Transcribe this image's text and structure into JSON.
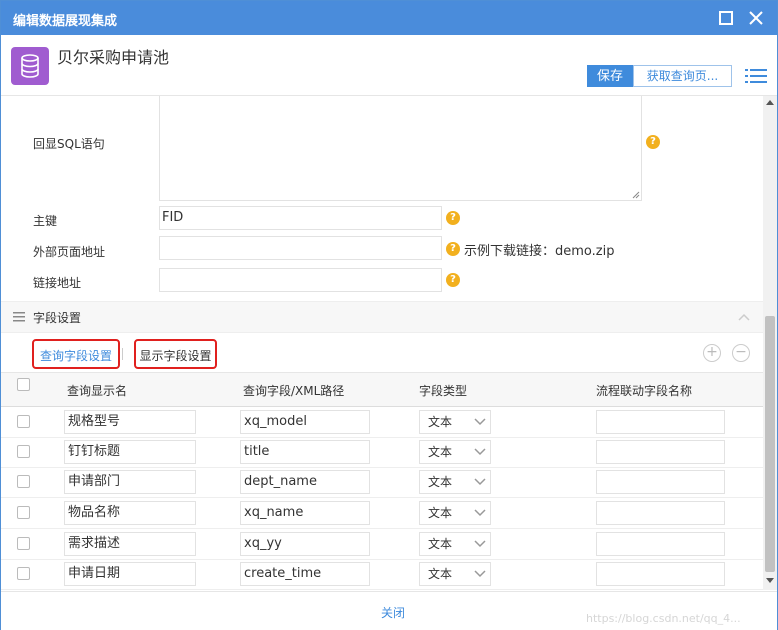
{
  "window": {
    "title": "编辑数据展现集成"
  },
  "header": {
    "app_title": "贝尔采购申请池",
    "save_label": "保存",
    "fetch_label": "获取查询页..."
  },
  "form": {
    "sql_label": "回显SQL语句",
    "pk_label": "主键",
    "pk_value": "FID",
    "external_url_label": "外部页面地址",
    "demo_hint": "示例下载链接：demo.zip",
    "link_url_label": "链接地址"
  },
  "section": {
    "title": "字段设置"
  },
  "tabs": {
    "query": "查询字段设置",
    "display": "显示字段设置"
  },
  "table": {
    "columns": [
      "查询显示名",
      "查询字段/XML路径",
      "字段类型",
      "流程联动字段名称"
    ],
    "rows": [
      {
        "name": "规格型号",
        "field": "xq_model",
        "type": "文本",
        "link": ""
      },
      {
        "name": "钉钉标题",
        "field": "title",
        "type": "文本",
        "link": ""
      },
      {
        "name": "申请部门",
        "field": "dept_name",
        "type": "文本",
        "link": ""
      },
      {
        "name": "物品名称",
        "field": "xq_name",
        "type": "文本",
        "link": ""
      },
      {
        "name": "需求描述",
        "field": "xq_yy",
        "type": "文本",
        "link": ""
      },
      {
        "name": "申请日期",
        "field": "create_time",
        "type": "文本",
        "link": ""
      }
    ]
  },
  "footer": {
    "close_label": "关闭",
    "watermark": "https://blog.csdn.net/qq_4..."
  },
  "colors": {
    "titlebar": "#4a8cdb",
    "accent": "#3f8bdc",
    "highlight_border": "#e0201e",
    "help_icon": "#f2b01e",
    "app_icon": "#a05cd0"
  },
  "icons": {
    "app": "database-icon",
    "maximize": "maximize-icon",
    "close": "close-icon",
    "menu": "menu-icon",
    "help": "question-icon"
  }
}
